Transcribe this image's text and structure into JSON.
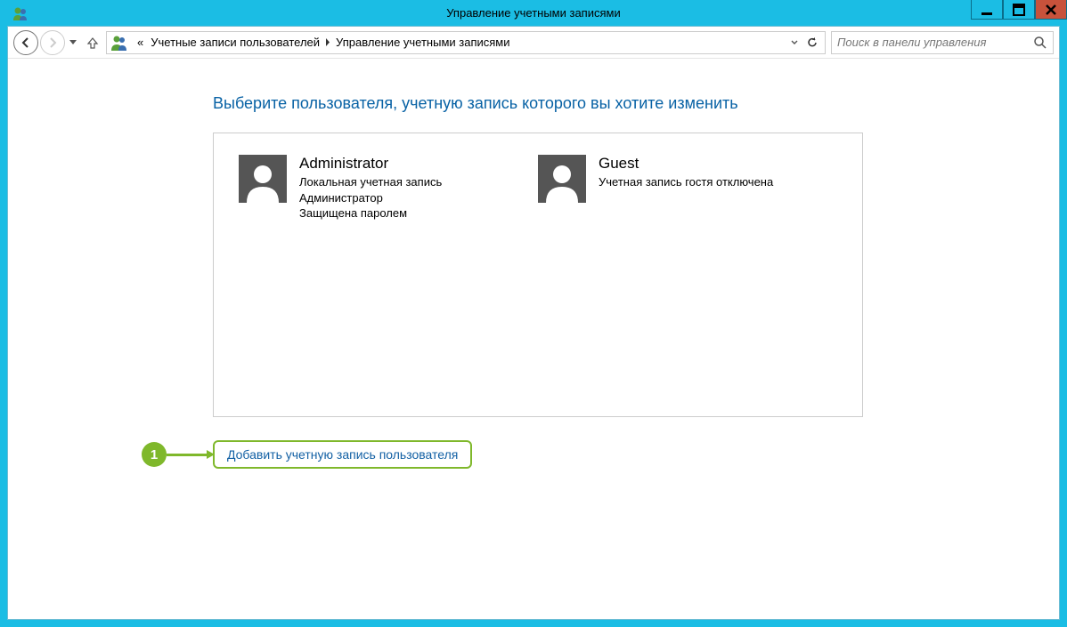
{
  "window": {
    "title": "Управление учетными записями"
  },
  "breadcrumb": {
    "prefix": "«",
    "item1": "Учетные записи пользователей",
    "item2": "Управление учетными записями"
  },
  "search": {
    "placeholder": "Поиск в панели управления"
  },
  "page": {
    "heading": "Выберите пользователя, учетную запись которого вы хотите изменить"
  },
  "users": [
    {
      "name": "Administrator",
      "lines": [
        "Локальная учетная запись",
        "Администратор",
        "Защищена паролем"
      ]
    },
    {
      "name": "Guest",
      "lines": [
        "Учетная запись гостя отключена"
      ]
    }
  ],
  "add_link": "Добавить учетную запись пользователя",
  "annotation": {
    "badge": "1"
  }
}
